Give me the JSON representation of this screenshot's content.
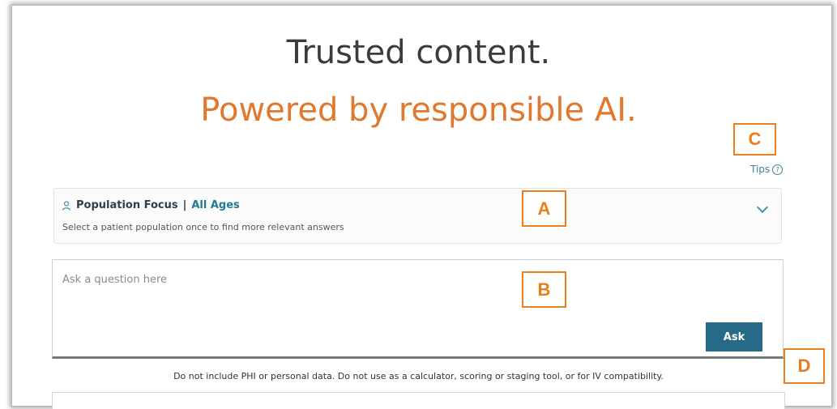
{
  "hero": {
    "line1": "Trusted content.",
    "line2": "Powered by responsible AI.",
    "line2_color": "#e0792d"
  },
  "tips": {
    "label": "Tips",
    "icon": "help-circle-icon"
  },
  "population": {
    "icon": "person-icon",
    "label": "Population Focus",
    "separator": "|",
    "value": "All Ages",
    "subtext": "Select a patient population once to find more relevant answers",
    "dropdown_icon": "chevron-down-icon"
  },
  "question": {
    "placeholder": "Ask a question here",
    "value": "",
    "ask_label": "Ask",
    "ask_color": "#266a88"
  },
  "disclaimer": "Do not include PHI or personal data. Do not use as a calculator, scoring or staging tool, or for IV compatibility.",
  "callouts": {
    "a": "A",
    "b": "B",
    "c": "C",
    "d": "D",
    "color": "#ec7d1a"
  }
}
